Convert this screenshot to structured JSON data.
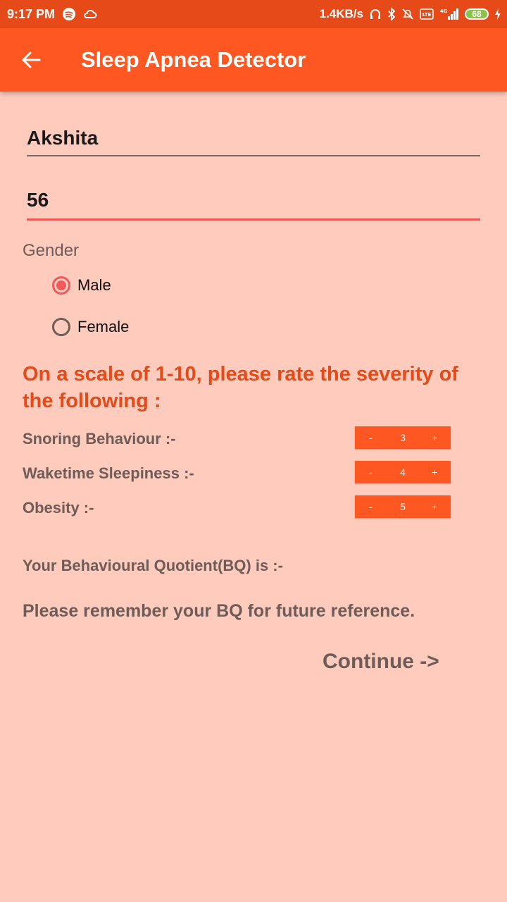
{
  "status_bar": {
    "time": "9:17 PM",
    "network_speed": "1.4KB/s",
    "network_type": "4G",
    "battery_level": "68",
    "icons": [
      "spotify-icon",
      "cloud-icon",
      "headphones-icon",
      "bluetooth-icon",
      "mute-alarm-icon",
      "volte-icon",
      "signal-icon",
      "battery-icon",
      "charging-icon"
    ]
  },
  "appbar": {
    "title": "Sleep Apnea Detector",
    "back_icon": "arrow-back-icon"
  },
  "form": {
    "name_value": "Akshita",
    "age_value": "56",
    "gender_label": "Gender",
    "gender_options": [
      {
        "label": "Male",
        "selected": true
      },
      {
        "label": "Female",
        "selected": false
      }
    ]
  },
  "rating": {
    "heading": "On a scale of 1-10, please rate the severity of the following :",
    "items": [
      {
        "label": "Snoring Behaviour :-",
        "value": "3"
      },
      {
        "label": "Waketime Sleepiness :-",
        "value": "4"
      },
      {
        "label": "Obesity :-",
        "value": "5"
      }
    ],
    "minus": "-",
    "plus": "+"
  },
  "bq": {
    "label": "Your Behavioural Quotient(BQ) is :-",
    "reminder": "Please remember your BQ for future reference."
  },
  "continue_label": "Continue ->",
  "colors": {
    "background": "#ffcbbc",
    "status_bar": "#e64a19",
    "app_bar": "#ff5722",
    "accent": "#f05a5a",
    "heading": "#e64a19",
    "text_muted": "#6d5c58"
  }
}
